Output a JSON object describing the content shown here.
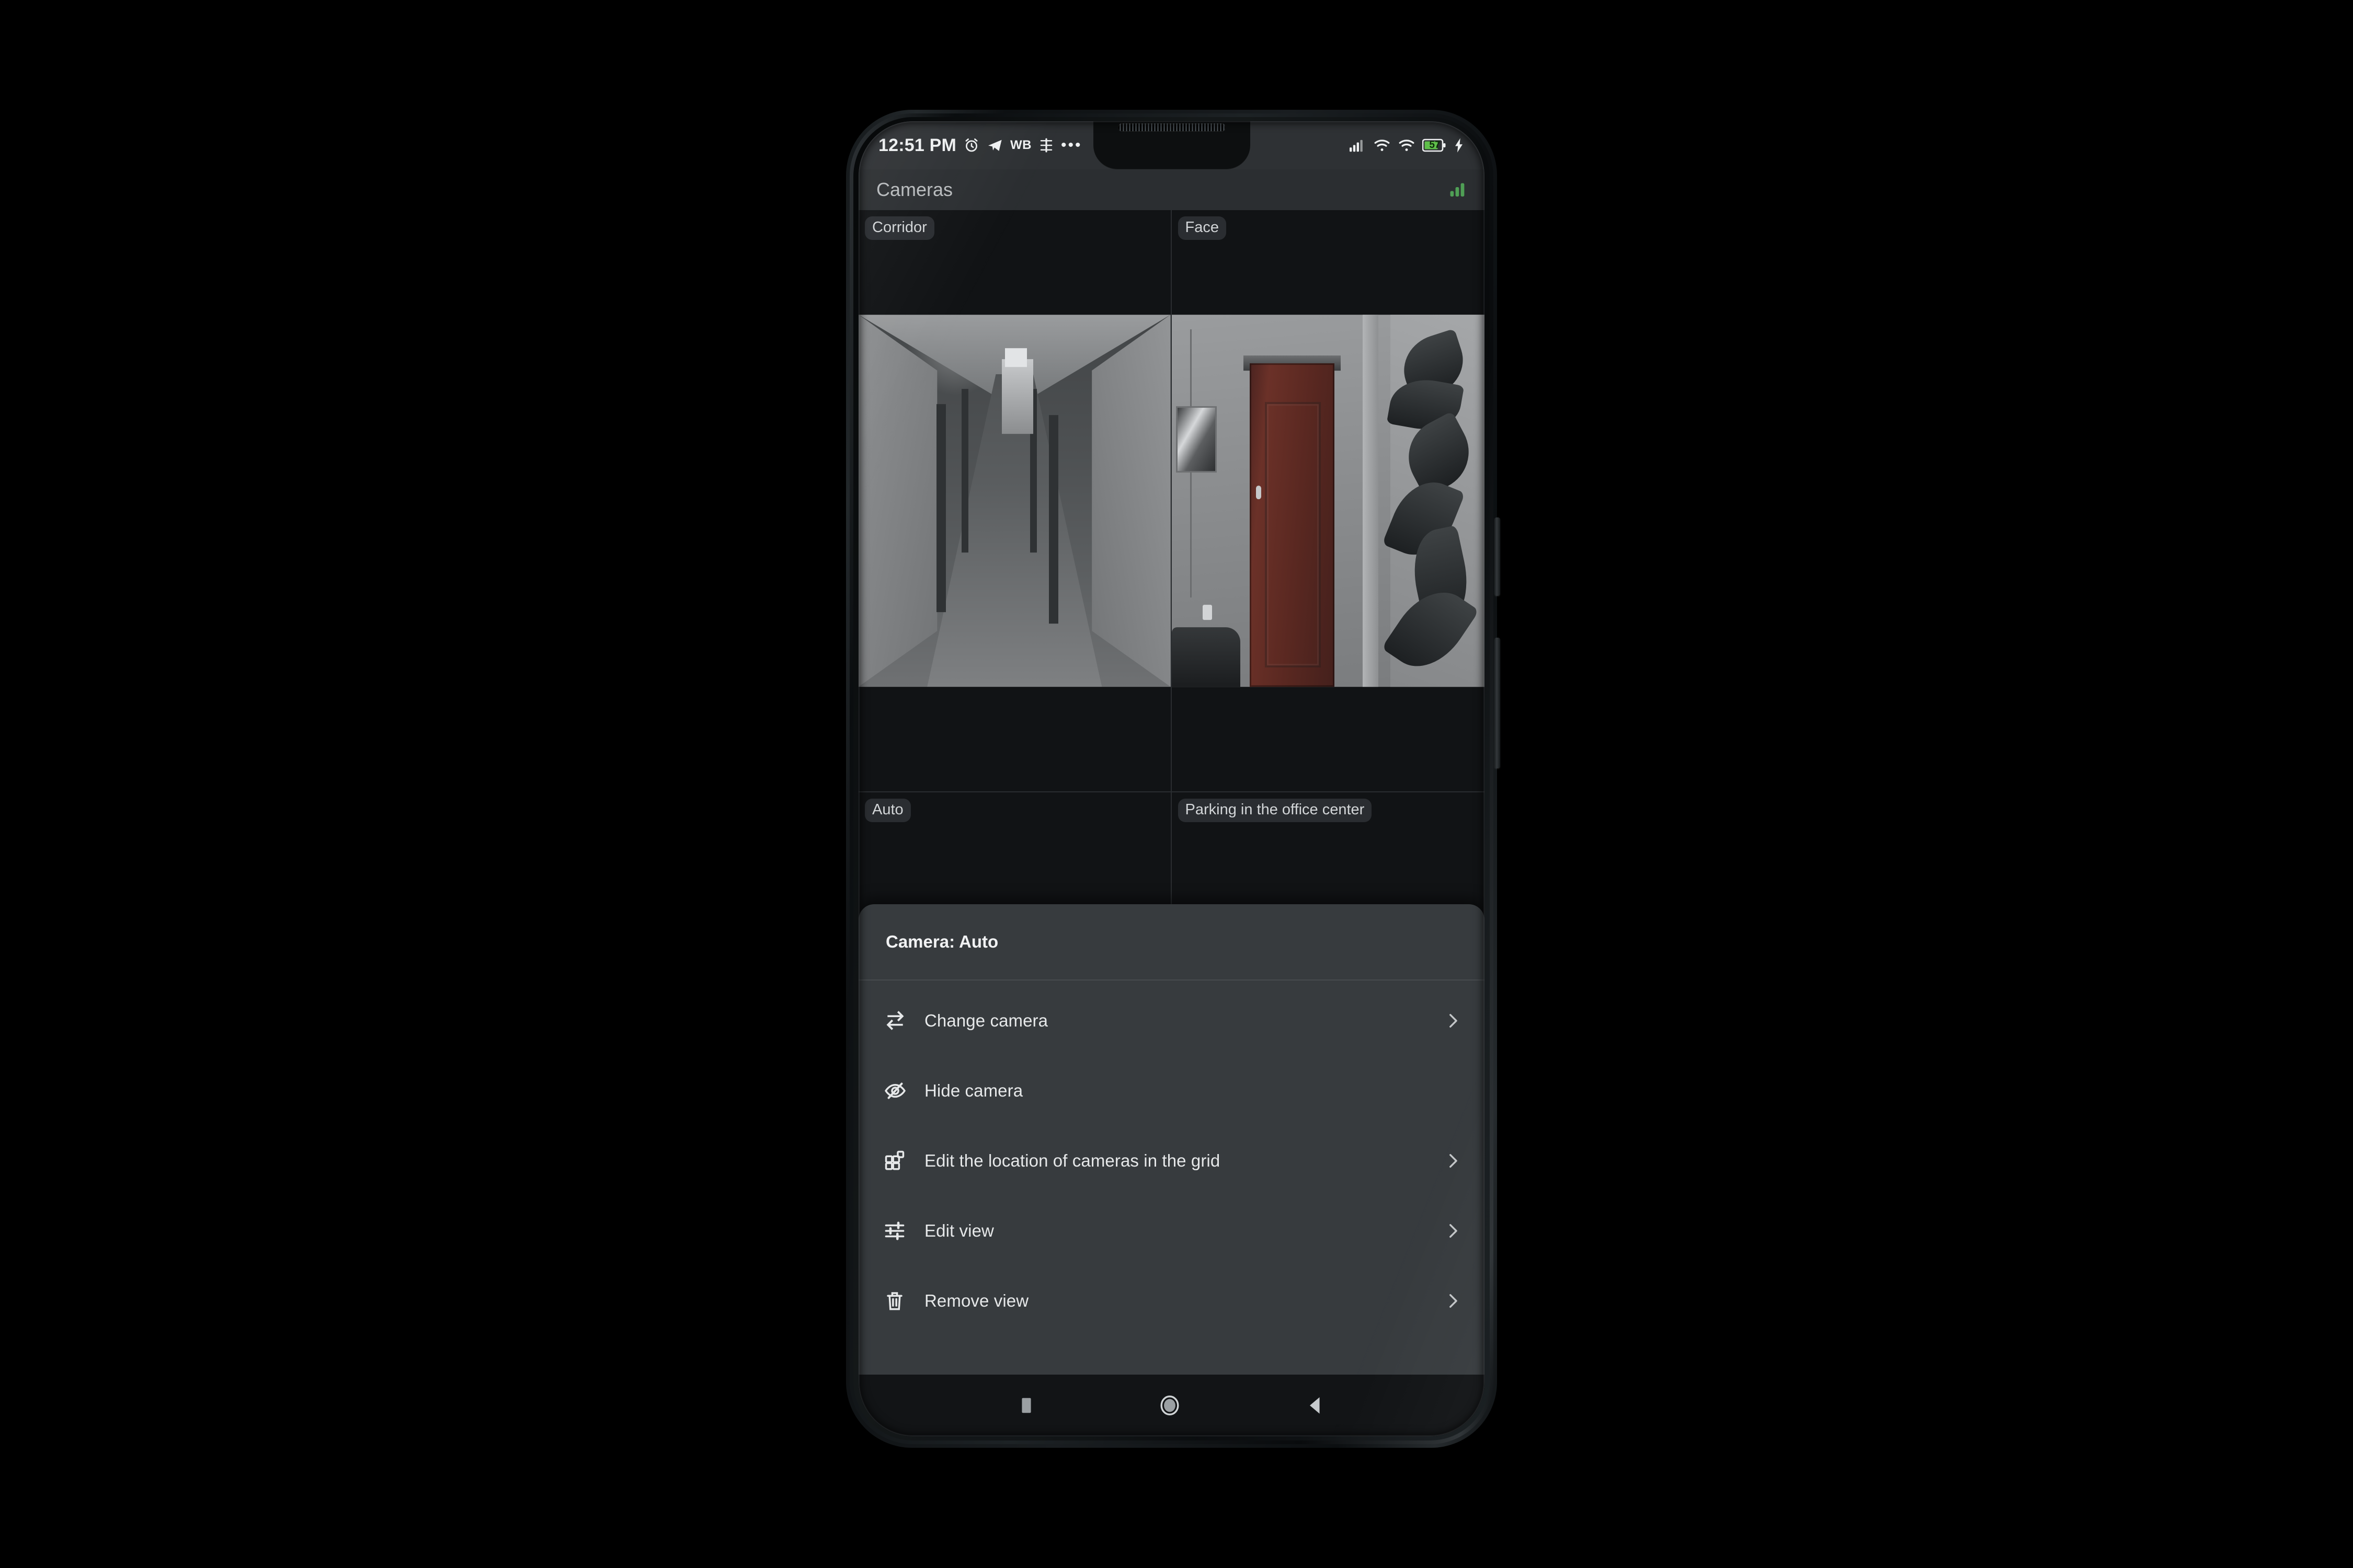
{
  "status_bar": {
    "time": "12:51 PM",
    "left_icons": [
      "alarm-clock-icon",
      "telegram-icon",
      "white-balance-icon",
      "equalizer-icon",
      "more-icons-ellipsis"
    ],
    "wb_text": "WB",
    "ellipsis": "•••",
    "right_icons": [
      "cellular-signal-icon",
      "wifi-icon",
      "wifi-secondary-icon",
      "battery-icon",
      "charging-bolt-icon"
    ],
    "battery_percent": "57",
    "battery_color": "#5fbf4a",
    "charging": true
  },
  "app_bar": {
    "title": "Cameras",
    "signal_icon": "signal-bars-icon",
    "signal_color": "#4f9f55"
  },
  "camera_grid": {
    "cells": [
      {
        "label": "Corridor",
        "has_video": true,
        "video": "corridor-view"
      },
      {
        "label": "Face",
        "has_video": true,
        "video": "door-room-view"
      },
      {
        "label": "Auto",
        "has_video": false,
        "video": ""
      },
      {
        "label": "Parking in the office center",
        "has_video": false,
        "video": ""
      }
    ]
  },
  "bottom_sheet": {
    "title": "Camera: Auto",
    "items": [
      {
        "label": "Change camera",
        "icon": "swap-arrows-icon",
        "chevron": true
      },
      {
        "label": "Hide camera",
        "icon": "eye-off-icon",
        "chevron": false
      },
      {
        "label": "Edit the location of cameras in the grid",
        "icon": "grid-layout-icon",
        "chevron": true
      },
      {
        "label": "Edit view",
        "icon": "sliders-icon",
        "chevron": true
      },
      {
        "label": "Remove view",
        "icon": "trash-icon",
        "chevron": true
      }
    ]
  },
  "nav_bar": {
    "buttons": [
      {
        "name": "recents-button",
        "icon": "square-icon"
      },
      {
        "name": "home-button",
        "icon": "circle-icon"
      },
      {
        "name": "back-button",
        "icon": "triangle-left-icon"
      }
    ]
  }
}
